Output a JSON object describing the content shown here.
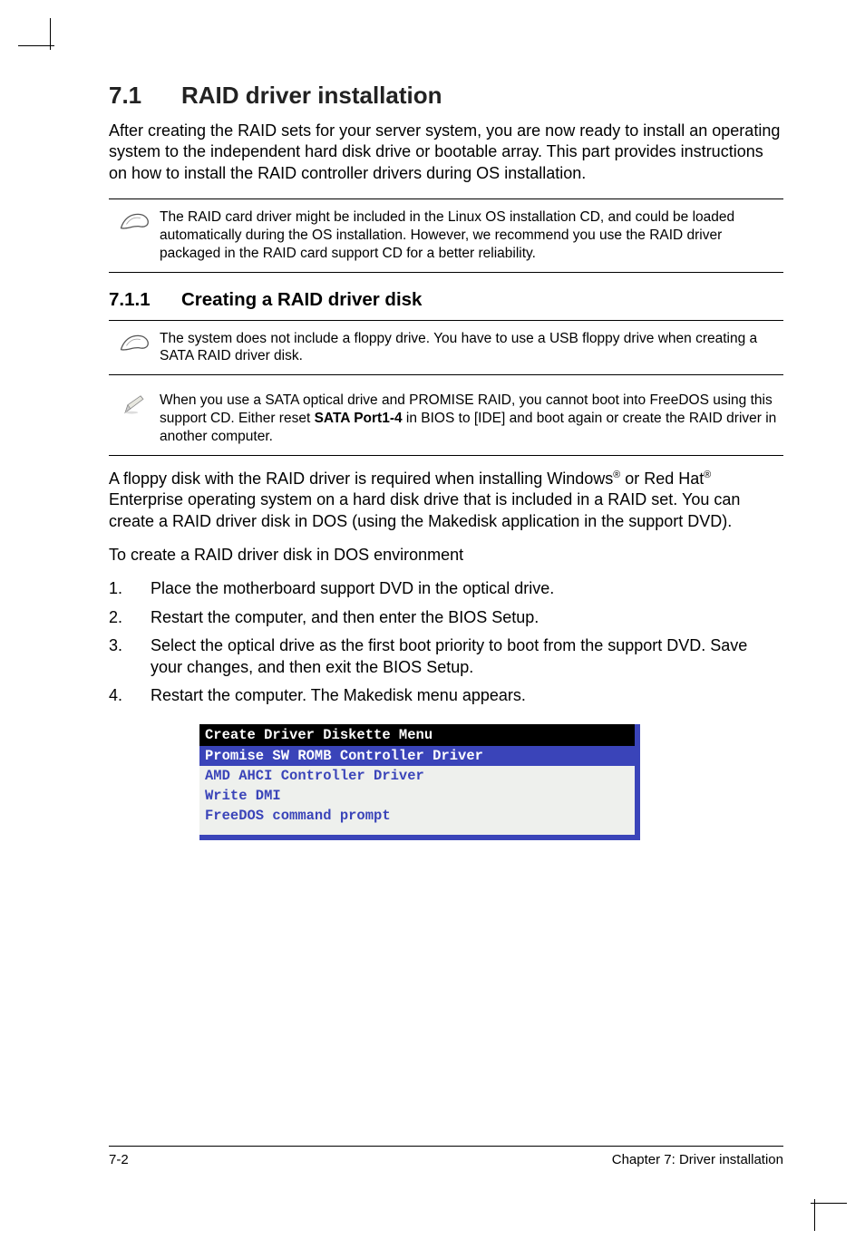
{
  "section": {
    "number": "7.1",
    "title": "RAID driver installation",
    "intro": "After creating the RAID sets for your server system, you are now ready to install an operating system to the independent hard disk drive or bootable array. This part provides instructions on how to install the RAID controller drivers during OS installation."
  },
  "note1": "The RAID card driver might be included in the Linux OS installation CD, and could be loaded automatically during the OS installation. However, we recommend you use the RAID driver packaged in the RAID card support CD for a better reliability.",
  "subsection": {
    "number": "7.1.1",
    "title": "Creating a RAID driver disk"
  },
  "note2": "The system does not include a floppy drive. You have to use a USB floppy drive when creating a SATA RAID driver disk.",
  "note3_pre": "When you use a SATA optical drive and PROMISE RAID, you cannot boot into FreeDOS using this support CD. Either reset ",
  "note3_bold": "SATA Port1-4",
  "note3_post": " in BIOS to [IDE] and boot again or create the RAID driver in another computer.",
  "para1_pre": "A floppy disk with the RAID driver is required when installing Windows",
  "para1_mid": " or Red Hat",
  "para1_post": " Enterprise operating system on a hard disk drive that is included in a RAID set. You can create a RAID driver disk in DOS (using the Makedisk application in the support DVD).",
  "para2": "To create a RAID driver disk in DOS environment",
  "steps": [
    "Place the motherboard support DVD in the optical drive.",
    "Restart the computer, and then enter the BIOS Setup.",
    "Select the optical drive as the first boot priority to boot from the support DVD. Save your changes, and then exit the BIOS Setup.",
    "Restart the computer. The Makedisk menu appears."
  ],
  "menu": {
    "header": " Create Driver Diskette Menu",
    "selected": " Promise SW ROMB Controller Driver",
    "items": [
      " AMD AHCI Controller Driver",
      " Write DMI",
      " FreeDOS command prompt"
    ]
  },
  "footer": {
    "page": "7-2",
    "chapter": "Chapter 7: Driver installation"
  }
}
